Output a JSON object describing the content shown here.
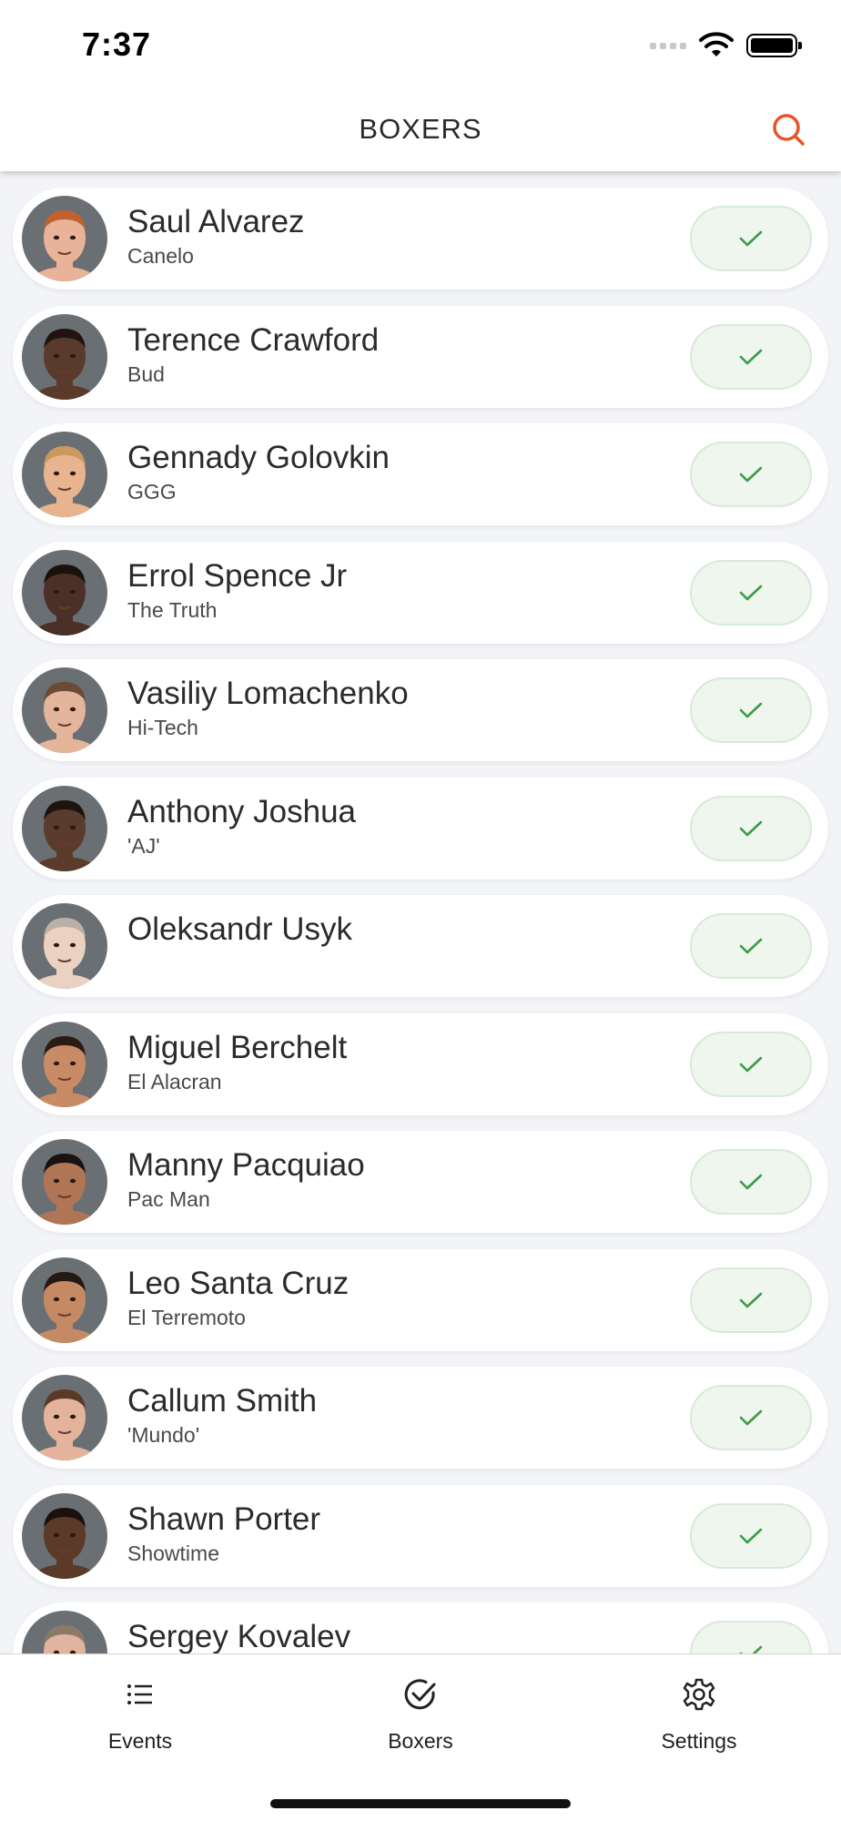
{
  "status_bar": {
    "time": "7:37"
  },
  "header": {
    "title": "BOXERS",
    "accent_color": "#e8542a"
  },
  "boxers": [
    {
      "name": "Saul Alvarez",
      "nickname": "Canelo",
      "skin": "#e9b39a",
      "hair": "#c2622f",
      "checked": true
    },
    {
      "name": "Terence Crawford",
      "nickname": "Bud",
      "skin": "#5a3a2a",
      "hair": "#1f1410",
      "checked": true
    },
    {
      "name": "Gennady Golovkin",
      "nickname": "GGG",
      "skin": "#e7b48f",
      "hair": "#c89a5e",
      "checked": true
    },
    {
      "name": "Errol Spence Jr",
      "nickname": "The Truth",
      "skin": "#4a3026",
      "hair": "#1a110d",
      "checked": true
    },
    {
      "name": "Vasiliy Lomachenko",
      "nickname": "Hi-Tech",
      "skin": "#e3b59b",
      "hair": "#6b4a36",
      "checked": true
    },
    {
      "name": "Anthony Joshua",
      "nickname": "'AJ'",
      "skin": "#5b3b2c",
      "hair": "#1d1410",
      "checked": true
    },
    {
      "name": "Oleksandr Usyk",
      "nickname": "",
      "skin": "#ead1c2",
      "hair": "#b9b1a7",
      "checked": true
    },
    {
      "name": "Miguel Berchelt",
      "nickname": "El Alacran",
      "skin": "#c98b66",
      "hair": "#2a1b14",
      "checked": true
    },
    {
      "name": "Manny Pacquiao",
      "nickname": "Pac Man",
      "skin": "#b07555",
      "hair": "#1a1210",
      "checked": true
    },
    {
      "name": "Leo Santa Cruz",
      "nickname": "El Terremoto",
      "skin": "#c58a64",
      "hair": "#231812",
      "checked": true
    },
    {
      "name": "Callum Smith",
      "nickname": "'Mundo'",
      "skin": "#e4b39b",
      "hair": "#5a3a26",
      "checked": true
    },
    {
      "name": "Shawn Porter",
      "nickname": "Showtime",
      "skin": "#5c3a28",
      "hair": "#1a110c",
      "checked": true
    },
    {
      "name": "Sergey Kovalev",
      "nickname": "",
      "skin": "#e0b49e",
      "hair": "#8c7a68",
      "checked": true
    }
  ],
  "tabs": [
    {
      "label": "Events",
      "icon": "list-icon"
    },
    {
      "label": "Boxers",
      "icon": "check-circle-icon"
    },
    {
      "label": "Settings",
      "icon": "gear-icon"
    }
  ],
  "check_color": "#3f9a4a"
}
